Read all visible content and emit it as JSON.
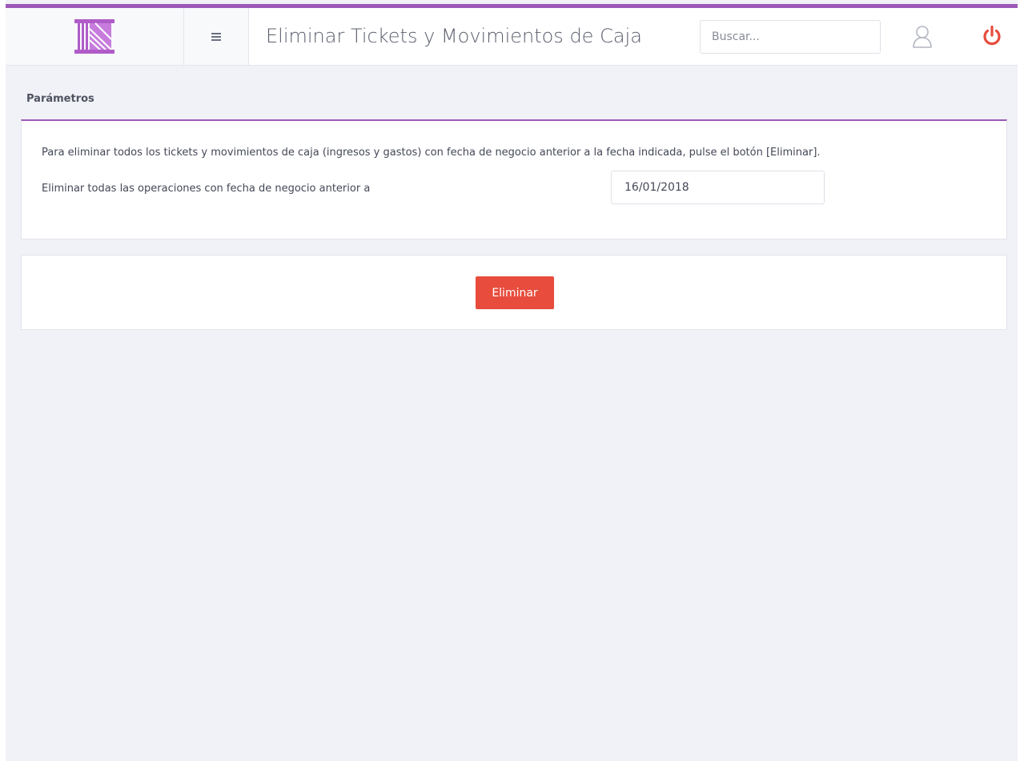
{
  "header": {
    "logo_icon": "building-columns-logo-icon",
    "menu_icon": "hamburger-menu-icon",
    "title": "Eliminar Tickets y Movimientos de Caja",
    "search": {
      "placeholder": "Buscar...",
      "value": ""
    },
    "user_icon": "user-icon",
    "power_icon": "power-off-icon",
    "accent_color": "#9b59b6",
    "power_color": "#e74c3c"
  },
  "params": {
    "section_title": "Parámetros",
    "description": "Para eliminar todos los tickets y movimientos de caja (ingresos y gastos) con fecha de negocio anterior a la fecha indicada, pulse el botón [Eliminar].",
    "date_label": "Eliminar todas las operaciones con fecha de negocio anterior a",
    "date_value": "16/01/2018"
  },
  "actions": {
    "delete_label": "Eliminar",
    "delete_color": "#e74c3c"
  }
}
